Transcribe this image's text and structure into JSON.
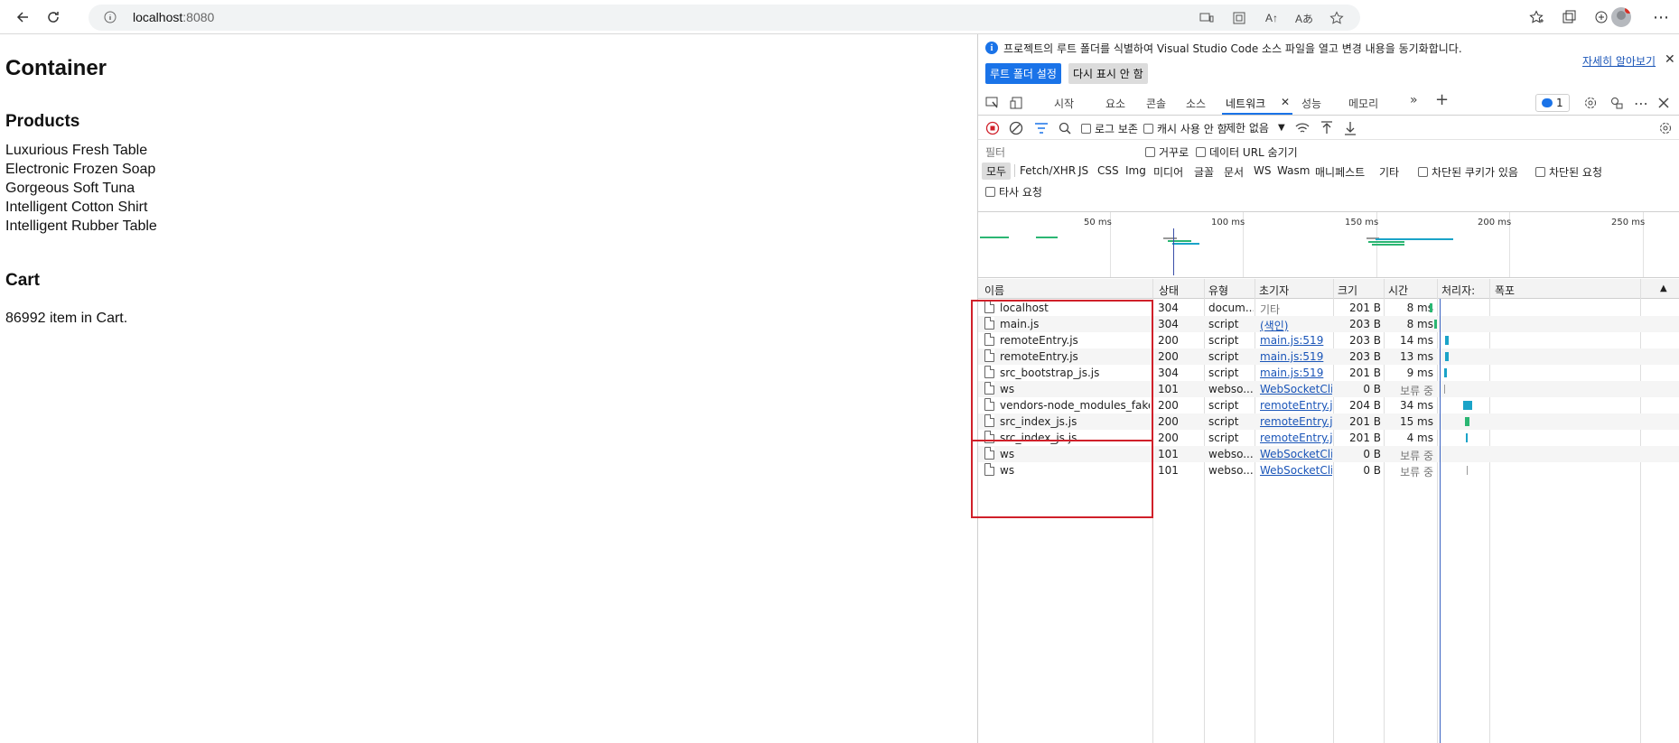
{
  "browser": {
    "url_host": "localhost",
    "url_port": ":8080",
    "reader_label": "Aあ",
    "font_label": "A↑"
  },
  "page": {
    "title": "Container",
    "products_heading": "Products",
    "products": [
      "Luxurious Fresh Table",
      "Electronic Frozen Soap",
      "Gorgeous Soft Tuna",
      "Intelligent Cotton Shirt",
      "Intelligent Rubber Table"
    ],
    "cart_heading": "Cart",
    "cart_text": "86992 item in Cart."
  },
  "devtools": {
    "infobar": {
      "message": "프로젝트의 루트 폴더를 식별하여 Visual Studio Code 소스 파일을 열고 변경 내용을 동기화합니다.",
      "learn_more": "자세히 알아보기",
      "primary_button": "루트 폴더 설정",
      "secondary_button": "다시 표시 안 함"
    },
    "tabs": [
      "시작",
      "요소",
      "콘솔",
      "소스",
      "네트워크",
      "성능",
      "메모리"
    ],
    "active_tab": "네트워크",
    "issues_count": "1",
    "toolbar": {
      "preserve_log": "로그 보존",
      "disable_cache": "캐시 사용 안 함",
      "throttling": "제한 없음"
    },
    "filter": {
      "placeholder": "필터",
      "invert": "거꾸로",
      "hide_data_urls": "데이터 URL 숨기기"
    },
    "types": [
      "모두",
      "Fetch/XHR",
      "JS",
      "CSS",
      "Img",
      "미디어",
      "글꼴",
      "문서",
      "WS",
      "Wasm",
      "매니페스트",
      "기타"
    ],
    "blocked_cookies": "차단된 쿠키가 있음",
    "blocked_requests": "차단된 요청",
    "third_party": "타사 요청",
    "overview_ticks": [
      "50 ms",
      "100 ms",
      "150 ms",
      "200 ms",
      "250 ms"
    ],
    "columns": {
      "name": "이름",
      "status": "상태",
      "type": "유형",
      "initiator": "초기자",
      "size": "크기",
      "time": "시간",
      "fulfilled": "처리자:",
      "waterfall": "폭포"
    },
    "rows": [
      {
        "name": "localhost",
        "status": "304",
        "type": "docum...",
        "initiator": "기타",
        "size": "201 B",
        "time": "8 ms"
      },
      {
        "name": "main.js",
        "status": "304",
        "type": "script",
        "initiator": "(색인)",
        "size": "203 B",
        "time": "8 ms"
      },
      {
        "name": "remoteEntry.js",
        "status": "200",
        "type": "script",
        "initiator": "main.js:519",
        "size": "203 B",
        "time": "14 ms"
      },
      {
        "name": "remoteEntry.js",
        "status": "200",
        "type": "script",
        "initiator": "main.js:519",
        "size": "203 B",
        "time": "13 ms"
      },
      {
        "name": "src_bootstrap_js.js",
        "status": "304",
        "type": "script",
        "initiator": "main.js:519",
        "size": "201 B",
        "time": "9 ms"
      },
      {
        "name": "ws",
        "status": "101",
        "type": "webso...",
        "initiator": "WebSocketCli...",
        "size": "0 B",
        "time": "보류 중"
      },
      {
        "name": "vendors-node_modules_fake...",
        "status": "200",
        "type": "script",
        "initiator": "remoteEntry.js:...",
        "size": "204 B",
        "time": "34 ms"
      },
      {
        "name": "src_index_js.js",
        "status": "200",
        "type": "script",
        "initiator": "remoteEntry.js:...",
        "size": "201 B",
        "time": "15 ms"
      },
      {
        "name": "src_index_js.js",
        "status": "200",
        "type": "script",
        "initiator": "remoteEntry.js:...",
        "size": "201 B",
        "time": "4 ms"
      },
      {
        "name": "ws",
        "status": "101",
        "type": "webso...",
        "initiator": "WebSocketCli...",
        "size": "0 B",
        "time": "보류 중"
      },
      {
        "name": "ws",
        "status": "101",
        "type": "webso...",
        "initiator": "WebSocketCli...",
        "size": "0 B",
        "time": "보류 중"
      }
    ]
  },
  "colors": {
    "accent": "#1a73e8",
    "highlight_box": "#d0202a",
    "link": "#1a55b8"
  }
}
